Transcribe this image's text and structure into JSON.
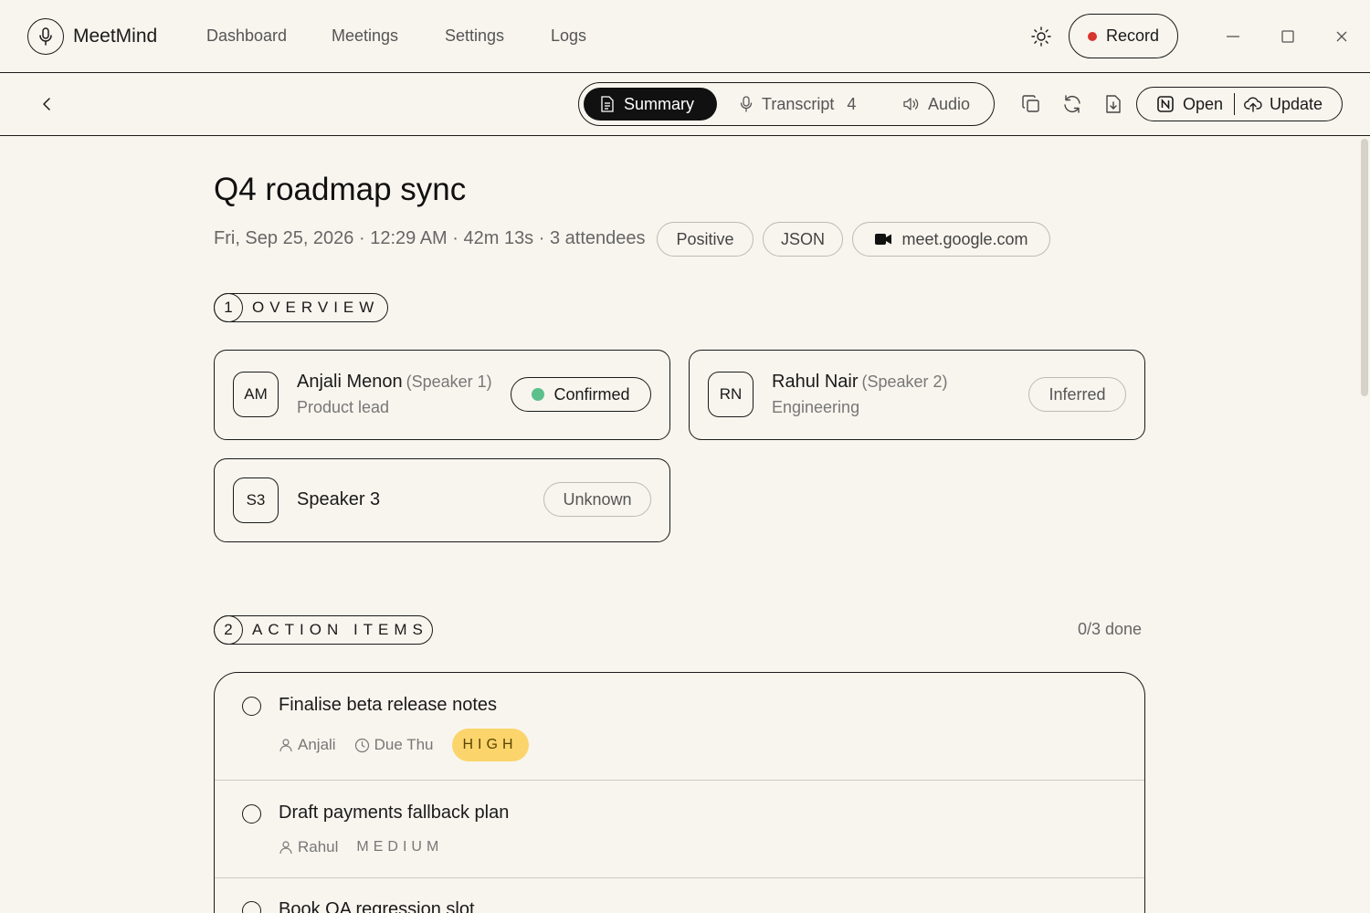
{
  "app": {
    "name": "MeetMind",
    "nav": [
      "Dashboard",
      "Meetings",
      "Settings",
      "Logs"
    ],
    "record_label": "Record"
  },
  "toolbar": {
    "tabs": [
      {
        "label": "Summary",
        "icon": "document-icon",
        "active": true
      },
      {
        "label": "Transcript",
        "count": "4",
        "icon": "mic-icon"
      },
      {
        "label": "Audio",
        "icon": "speaker-icon"
      }
    ],
    "open_label": "Open",
    "update_label": "Update"
  },
  "meeting": {
    "title": "Q4 roadmap sync",
    "meta": "Fri, Sep 25, 2026 · 12:29 AM · 42m 13s · 3 attendees",
    "pills": {
      "sentiment": "Positive",
      "format": "JSON",
      "source": "meet.google.com"
    }
  },
  "overview": {
    "number": "1",
    "label": "OVERVIEW",
    "speakers": [
      {
        "initials": "AM",
        "name": "Anjali Menon",
        "tag": "(Speaker 1)",
        "role": "Product lead",
        "status": "Confirmed"
      },
      {
        "initials": "RN",
        "name": "Rahul Nair",
        "tag": "(Speaker 2)",
        "role": "Engineering",
        "status": "Inferred"
      },
      {
        "initials": "S3",
        "name": "Speaker 3",
        "status": "Unknown"
      }
    ]
  },
  "actions": {
    "number": "2",
    "label": "ACTION ITEMS",
    "done": "0/3 done",
    "items": [
      {
        "title": "Finalise beta release notes",
        "owner": "Anjali",
        "due": "Due Thu",
        "priority": "HIGH"
      },
      {
        "title": "Draft payments fallback plan",
        "owner": "Rahul",
        "priority": "MEDIUM"
      },
      {
        "title": "Book QA regression slot"
      }
    ]
  },
  "colors": {
    "background": "#f8f5ee",
    "record_dot": "#d7352e",
    "confirmed_dot": "#5cc08c",
    "priority_high": "#fbd56b"
  }
}
